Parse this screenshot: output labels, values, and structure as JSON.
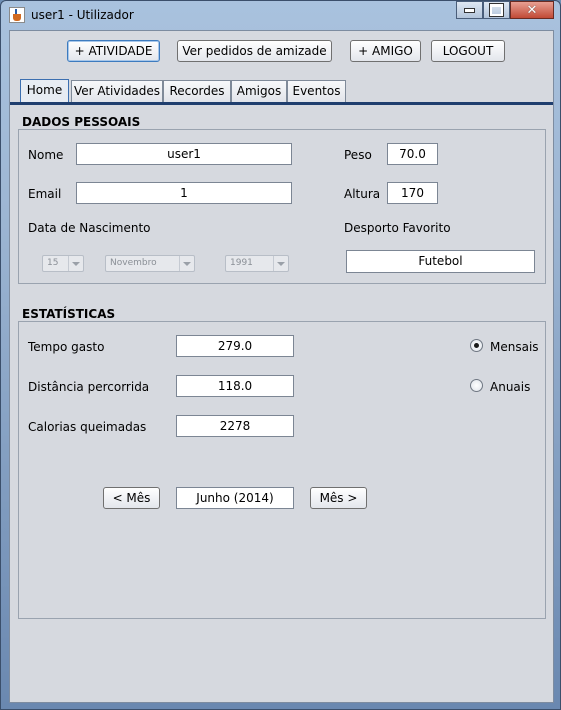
{
  "window": {
    "title": "user1 - Utilizador"
  },
  "toolbar": {
    "atividade_label": "+ ATIVIDADE",
    "pedidos_label": "Ver pedidos de amizade",
    "amigo_label": "+ AMIGO",
    "logout_label": "LOGOUT"
  },
  "tabs": [
    {
      "label": "Home",
      "selected": true
    },
    {
      "label": "Ver Atividades",
      "selected": false
    },
    {
      "label": "Recordes",
      "selected": false
    },
    {
      "label": "Amigos",
      "selected": false
    },
    {
      "label": "Eventos",
      "selected": false
    }
  ],
  "pessoais": {
    "heading": "DADOS PESSOAIS",
    "nome_label": "Nome",
    "nome_value": "user1",
    "email_label": "Email",
    "email_value": "1",
    "peso_label": "Peso",
    "peso_value": "70.0",
    "altura_label": "Altura",
    "altura_value": "170",
    "nascimento_label": "Data de Nascimento",
    "dia": "15",
    "mes": "Novembro",
    "ano": "1991",
    "desporto_label": "Desporto Favorito",
    "desporto_value": "Futebol"
  },
  "estatisticas": {
    "heading": "ESTATÍSTICAS",
    "tempo_label": "Tempo gasto",
    "tempo_value": "279.0",
    "distancia_label": "Distância percorrida",
    "distancia_value": "118.0",
    "calorias_label": "Calorias queimadas",
    "calorias_value": "2278",
    "mensais_label": "Mensais",
    "anuais_label": "Anuais",
    "periodo_selected": "Mensais",
    "prev_label": "< Mês",
    "period_value": "Junho (2014)",
    "next_label": "Mês >"
  }
}
